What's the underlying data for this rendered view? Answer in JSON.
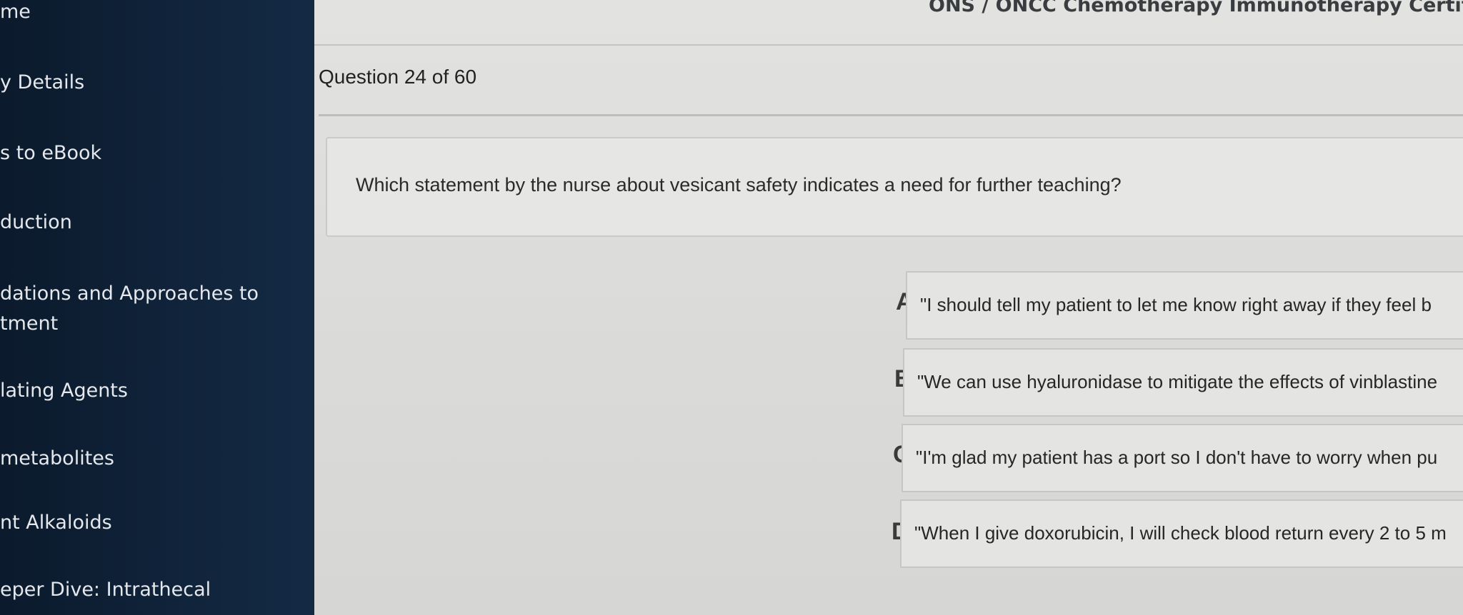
{
  "sidebar": {
    "items": [
      {
        "label": "me"
      },
      {
        "label": "y Details"
      },
      {
        "label": "s to eBook"
      },
      {
        "label": "duction"
      },
      {
        "label": "dations and Approaches to",
        "label2": "tment"
      },
      {
        "label": "lating Agents"
      },
      {
        "label": "metabolites"
      },
      {
        "label": "nt Alkaloids"
      },
      {
        "label": "eper Dive: Intrathecal"
      }
    ]
  },
  "header": {
    "app_title": "ONS / ONCC Chemotherapy Immunotherapy Certificate"
  },
  "question": {
    "counter": "Question 24 of 60",
    "text": "Which statement by the nurse about vesicant safety indicates a need for further teaching?"
  },
  "options": [
    {
      "letter": "A.",
      "text": "\"I should tell my patient to let me know right away if they feel b"
    },
    {
      "letter": "B.",
      "text": "\"We can use hyaluronidase to mitigate the effects of vinblastine"
    },
    {
      "letter": "C.",
      "text": "\"I'm glad my patient has a port so I don't have to worry when pu"
    },
    {
      "letter": "D.",
      "text": "\"When I give doxorubicin, I will check blood return every 2 to 5 m"
    }
  ]
}
